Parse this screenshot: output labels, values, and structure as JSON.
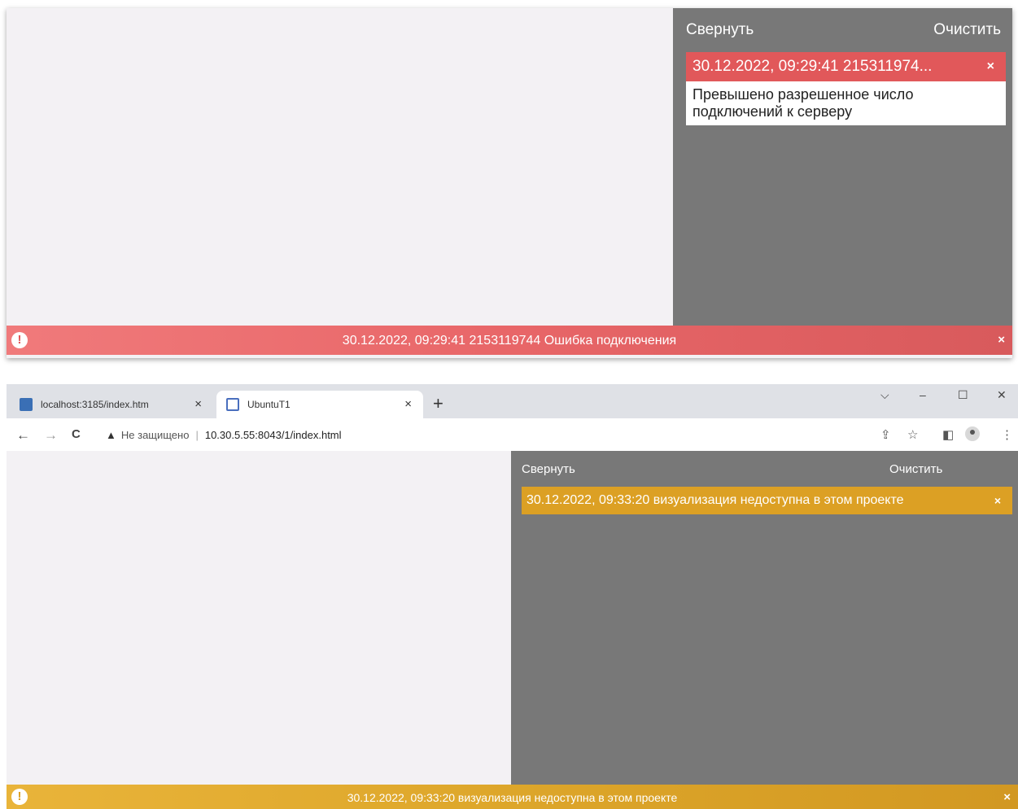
{
  "shot1": {
    "panel": {
      "collapse_label": "Свернуть",
      "clear_label": "Очистить",
      "notification": {
        "title": "30.12.2022, 09:29:41 215311974...",
        "close_label": "×",
        "body": "Превышено разрешенное число подключений к серверу",
        "color": "#e1585a"
      }
    },
    "status_bar": {
      "icon": "warning-circle-icon",
      "message": "30.12.2022, 09:29:41 2153119744 Ошибка подключения",
      "close_label": "×",
      "color": "#e86668"
    }
  },
  "shot2": {
    "browser": {
      "tabs": [
        {
          "label": "localhost:3185/index.htm",
          "close_label": "×",
          "active": false
        },
        {
          "label": "UbuntuT1",
          "close_label": "×",
          "active": true
        }
      ],
      "new_tab_label": "+",
      "window_controls": {
        "dropdown": "⌵",
        "minimize": "–",
        "maximize": "☐",
        "close": "✕"
      },
      "nav": {
        "back": "←",
        "forward": "→",
        "reload": "C"
      },
      "address": {
        "security_icon": "warning-triangle-icon",
        "security_text": "Не защищено",
        "url": "10.30.5.55:8043/1/index.html"
      },
      "toolbar_icons": [
        "share-icon",
        "star-icon",
        "side-panel-icon",
        "profile-icon",
        "menu-icon"
      ]
    },
    "panel": {
      "collapse_label": "Свернуть",
      "clear_label": "Очистить",
      "notification": {
        "title": "30.12.2022, 09:33:20 визуализация недоступна в этом проекте",
        "close_label": "×",
        "color": "#dca024"
      }
    },
    "status_bar": {
      "icon": "warning-circle-icon",
      "message": "30.12.2022, 09:33:20 визуализация недоступна в этом проекте",
      "close_label": "×",
      "color": "#dda62a"
    }
  }
}
